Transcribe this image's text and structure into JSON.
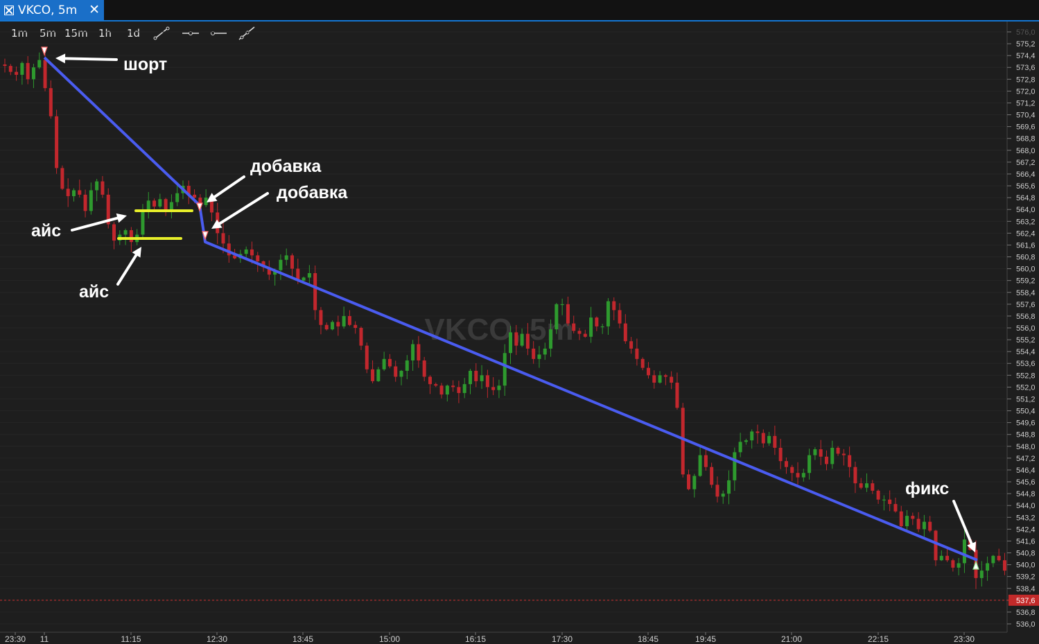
{
  "window": {
    "tab_title": "VKCO, 5m",
    "tab_icon": "chart-window-icon",
    "close_icon": "close-icon"
  },
  "toolbar": {
    "timeframes": [
      "1m",
      "5m",
      "15m",
      "1h",
      "1d"
    ],
    "tools": [
      "trend-line-icon",
      "horizontal-ray-icon",
      "horizontal-line-icon",
      "ray-icon"
    ]
  },
  "chart_data": {
    "type": "candlestick",
    "symbol_watermark": "VKCO, 5m",
    "y_ticks": [
      "576,0",
      "575,2",
      "574,4",
      "573,6",
      "572,8",
      "572,0",
      "571,2",
      "570,4",
      "569,6",
      "568,8",
      "568,0",
      "567,2",
      "566,4",
      "565,6",
      "564,8",
      "564,0",
      "563,2",
      "562,4",
      "561,6",
      "560,8",
      "560,0",
      "559,2",
      "558,4",
      "557,6",
      "556,8",
      "556,0",
      "555,2",
      "554,4",
      "553,6",
      "552,8",
      "552,0",
      "551,2",
      "550,4",
      "549,6",
      "548,8",
      "548,0",
      "547,2",
      "546,4",
      "545,6",
      "544,8",
      "544,0",
      "543,2",
      "542,4",
      "541,6",
      "540,8",
      "540,0",
      "539,2",
      "538,4",
      "537,6",
      "536,8",
      "536,0"
    ],
    "y_range": [
      536.0,
      576.0
    ],
    "x_ticks": [
      "23:30",
      "11",
      "11:15",
      "12:30",
      "13:45",
      "15:00",
      "16:15",
      "17:30",
      "18:45",
      "19:45",
      "21:00",
      "22:15",
      "23:30"
    ],
    "current_price": "537,6",
    "colors": {
      "up": "#2e9a2e",
      "down": "#c2272d",
      "trend_line": "#4a5cf0",
      "level_line": "#e8ef2a",
      "current_price": "#d03030"
    },
    "closes": [
      573.7,
      573.3,
      573.1,
      573.9,
      572.8,
      573.6,
      574.1,
      572.2,
      570.3,
      566.8,
      565.4,
      564.9,
      565.3,
      565.0,
      563.9,
      565.3,
      565.9,
      565.0,
      563.0,
      561.9,
      562.3,
      562.6,
      561.8,
      562.3,
      563.9,
      564.6,
      564.2,
      564.7,
      563.9,
      564.5,
      565.1,
      565.6,
      565.0,
      564.8,
      564.3,
      564.8,
      563.8,
      562.4,
      561.7,
      560.9,
      560.7,
      561.0,
      561.3,
      560.9,
      560.5,
      560.1,
      559.6,
      559.9,
      560.6,
      560.9,
      560.0,
      559.2,
      559.4,
      559.7,
      557.2,
      556.2,
      555.9,
      556.4,
      556.1,
      556.8,
      556.2,
      556.0,
      554.8,
      553.2,
      552.4,
      553.2,
      553.9,
      553.4,
      552.7,
      553.1,
      553.8,
      554.9,
      553.8,
      552.7,
      552.2,
      552.1,
      551.5,
      552.1,
      552.0,
      551.6,
      552.2,
      553.1,
      552.4,
      552.8,
      552.0,
      551.8,
      552.1,
      554.3,
      555.7,
      554.8,
      555.6,
      554.6,
      553.9,
      554.2,
      554.6,
      555.9,
      557.6,
      557.6,
      556.3,
      555.8,
      555.6,
      555.4,
      556.7,
      556.1,
      556.1,
      557.8,
      557.2,
      556.3,
      555.1,
      554.6,
      553.9,
      553.3,
      552.8,
      552.3,
      552.8,
      552.7,
      552.3,
      550.6,
      546.1,
      545.1,
      546.0,
      547.4,
      546.6,
      545.4,
      544.6,
      544.8,
      545.7,
      547.6,
      548.3,
      548.4,
      549.0,
      548.9,
      548.2,
      548.7,
      547.9,
      547.0,
      546.6,
      546.2,
      545.9,
      546.2,
      547.4,
      547.8,
      547.3,
      546.8,
      547.9,
      547.5,
      547.4,
      546.6,
      545.5,
      545.2,
      545.5,
      545.0,
      544.4,
      544.4,
      544.1,
      543.6,
      542.6,
      543.3,
      543.1,
      542.4,
      542.9,
      542.3,
      540.3,
      540.6,
      540.3,
      539.8,
      540.1,
      541.7,
      541.0,
      539.1,
      539.6,
      540.1,
      540.6,
      540.3,
      539.6,
      540.7,
      540.3,
      540.5,
      540.4,
      539.5,
      537.8
    ],
    "annotations": [
      {
        "text": "шорт",
        "kind": "short-entry"
      },
      {
        "text": "добавка",
        "kind": "add-position"
      },
      {
        "text": "добавка",
        "kind": "add-position"
      },
      {
        "text": "айс",
        "kind": "iceberg-level"
      },
      {
        "text": "айс",
        "kind": "iceberg-level"
      },
      {
        "text": "фикс",
        "kind": "take-profit"
      }
    ]
  }
}
